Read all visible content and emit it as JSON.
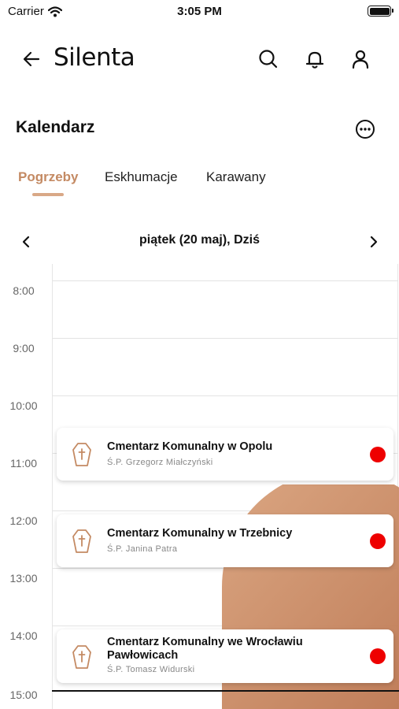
{
  "status_bar": {
    "carrier": "Carrier",
    "time": "3:05 PM"
  },
  "header": {
    "brand": "Silenta"
  },
  "page": {
    "title": "Kalendarz"
  },
  "tabs": [
    {
      "label": "Pogrzeby",
      "active": true
    },
    {
      "label": "Eskhumacje",
      "active": false
    },
    {
      "label": "Karawany",
      "active": false
    }
  ],
  "date_nav": {
    "label": "piątek (20 maj), Dziś"
  },
  "hours": [
    "8:00",
    "9:00",
    "10:00",
    "11:00",
    "12:00",
    "13:00",
    "14:00",
    "15:00"
  ],
  "events": [
    {
      "title": "Cmentarz Komunalny w Opolu",
      "subtitle": "Ś.P. Grzegorz Miałczyński",
      "status_color": "#ee0000"
    },
    {
      "title": "Cmentarz Komunalny w Trzebnicy",
      "subtitle": "Ś.P. Janina Patra",
      "status_color": "#ee0000"
    },
    {
      "title": "Cmentarz Komunalny we Wrocławiu Pawłowicach",
      "subtitle": "Ś.P. Tomasz Widurski",
      "status_color": "#ee0000"
    }
  ],
  "colors": {
    "accent": "#c48a63",
    "accent_light": "#d9a887",
    "status": "#ee0000"
  },
  "icons": [
    "wifi-icon",
    "battery-icon",
    "back-arrow-icon",
    "search-icon",
    "bell-icon",
    "user-icon",
    "more-icon",
    "chevron-left-icon",
    "chevron-right-icon",
    "coffin-icon"
  ]
}
